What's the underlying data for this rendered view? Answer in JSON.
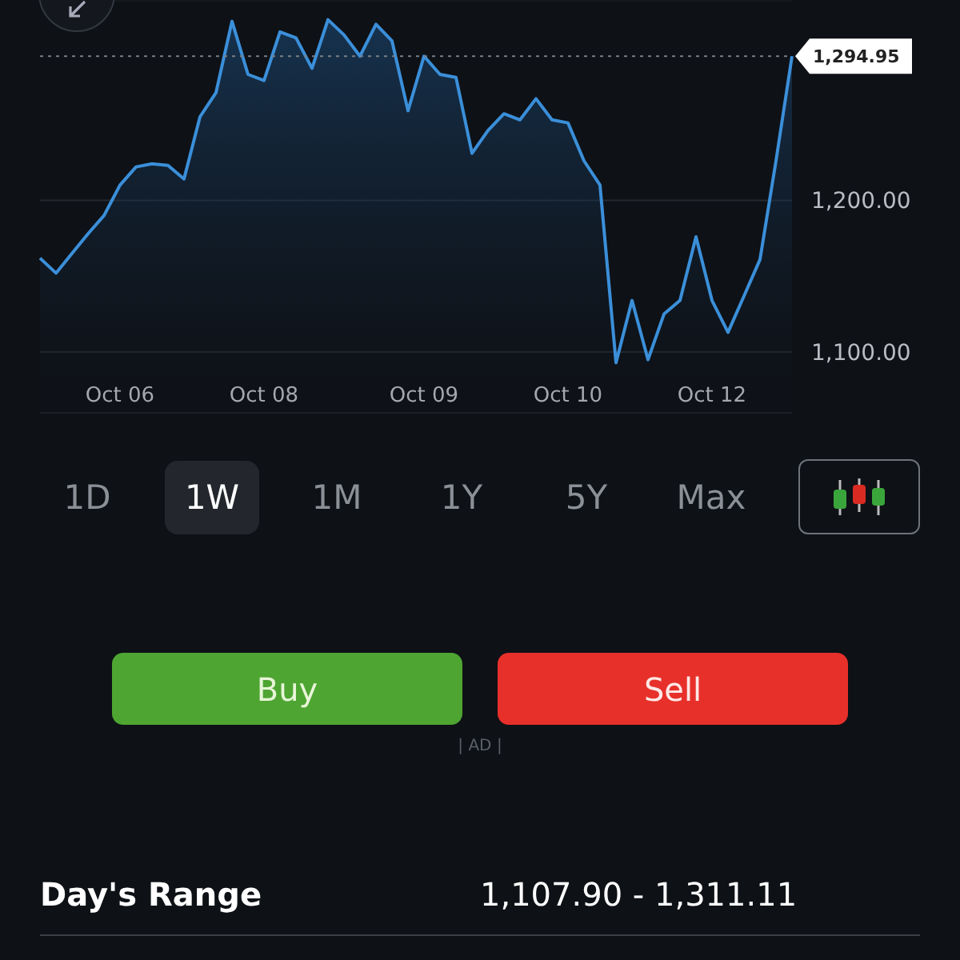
{
  "chart": {
    "chart_data": {
      "type": "area",
      "ref_lines": [
        {
          "axis": "y",
          "value": 1294.95,
          "label": "1,294.95"
        }
      ],
      "ylim": [
        1060,
        1332
      ],
      "categories": [
        null,
        null,
        null,
        null,
        null,
        "Oct 06",
        null,
        null,
        null,
        null,
        null,
        null,
        null,
        null,
        "Oct 08",
        null,
        null,
        null,
        null,
        null,
        null,
        null,
        null,
        null,
        "Oct 09",
        null,
        null,
        null,
        null,
        null,
        null,
        null,
        null,
        "Oct 10",
        null,
        null,
        null,
        null,
        null,
        null,
        null,
        null,
        "Oct 12",
        null,
        null,
        null,
        null,
        null
      ],
      "series": [
        {
          "color": "#3b8fd9",
          "values": [
            1162,
            1152,
            1165,
            1178,
            1190,
            1210,
            1222,
            1224,
            1223,
            1214,
            1255,
            1271,
            1318,
            1283,
            1279,
            1311,
            1307,
            1287,
            1319,
            1309,
            1295,
            1316,
            1305,
            1259,
            1295,
            1283,
            1281,
            1231,
            1246,
            1257,
            1253,
            1267,
            1253,
            1251,
            1226,
            1210,
            1093,
            1134,
            1095,
            1125,
            1134,
            1176,
            1134,
            1113,
            1137,
            1161,
            1226,
            1295
          ]
        }
      ],
      "yticks": [
        {
          "value": 1100,
          "label": "1,100.00"
        },
        {
          "value": 1200,
          "label": "1,200.00"
        }
      ]
    }
  },
  "timeframes": [
    {
      "label": "1D",
      "selected": false
    },
    {
      "label": "1W",
      "selected": true
    },
    {
      "label": "1M",
      "selected": false
    },
    {
      "label": "1Y",
      "selected": false
    },
    {
      "label": "5Y",
      "selected": false
    },
    {
      "label": "Max",
      "selected": false
    }
  ],
  "actions": [
    {
      "label": "Buy",
      "kind": "buy"
    },
    {
      "label": "Sell",
      "kind": "sell"
    }
  ],
  "ad_label": "| AD |",
  "stats": [
    {
      "label": "Day's Range",
      "value": "1,107.90 - 1,311.11"
    }
  ]
}
